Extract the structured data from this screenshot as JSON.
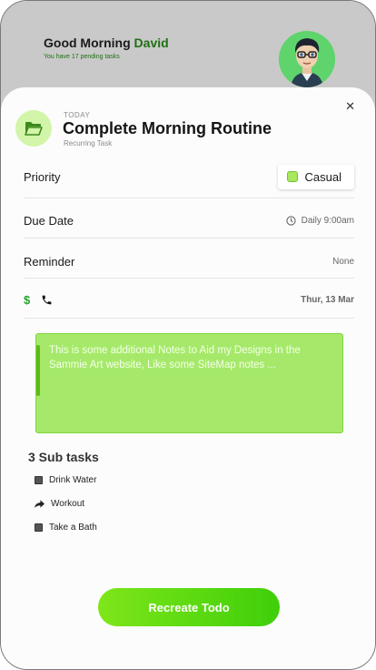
{
  "header": {
    "greeting": "Good Morning",
    "user_name": "David",
    "pending_text": "You have 17 pending tasks"
  },
  "task": {
    "day_label": "TODAY",
    "title": "Complete Morning Routine",
    "type": "Recurring Task",
    "close_icon": "close-icon",
    "folder_icon": "folder-open-icon"
  },
  "details": {
    "priority_label": "Priority",
    "priority_value": "Casual",
    "due_label": "Due Date",
    "due_value": "Daily 9:00am",
    "reminder_label": "Reminder",
    "reminder_value": "None",
    "action_icons": [
      "dollar-icon",
      "phone-icon"
    ],
    "date_value": "Thur, 13 Mar"
  },
  "notes": {
    "text": "This is some additional Notes to Aid my Designs in the Sammie Art website, Like some SiteMap notes ..."
  },
  "subtasks": {
    "title": "3 Sub tasks",
    "items": [
      {
        "label": "Drink Water",
        "icon": "checkbox-icon"
      },
      {
        "label": "Workout",
        "icon": "share-arrow-icon"
      },
      {
        "label": "Take a Bath",
        "icon": "checkbox-icon"
      }
    ]
  },
  "actions": {
    "recreate_label": "Recreate Todo"
  },
  "colors": {
    "accent": "#7ee619",
    "name_green": "#1f6f12",
    "notes_bg": "#a6e96a",
    "chip_fill": "#a8e85c"
  }
}
